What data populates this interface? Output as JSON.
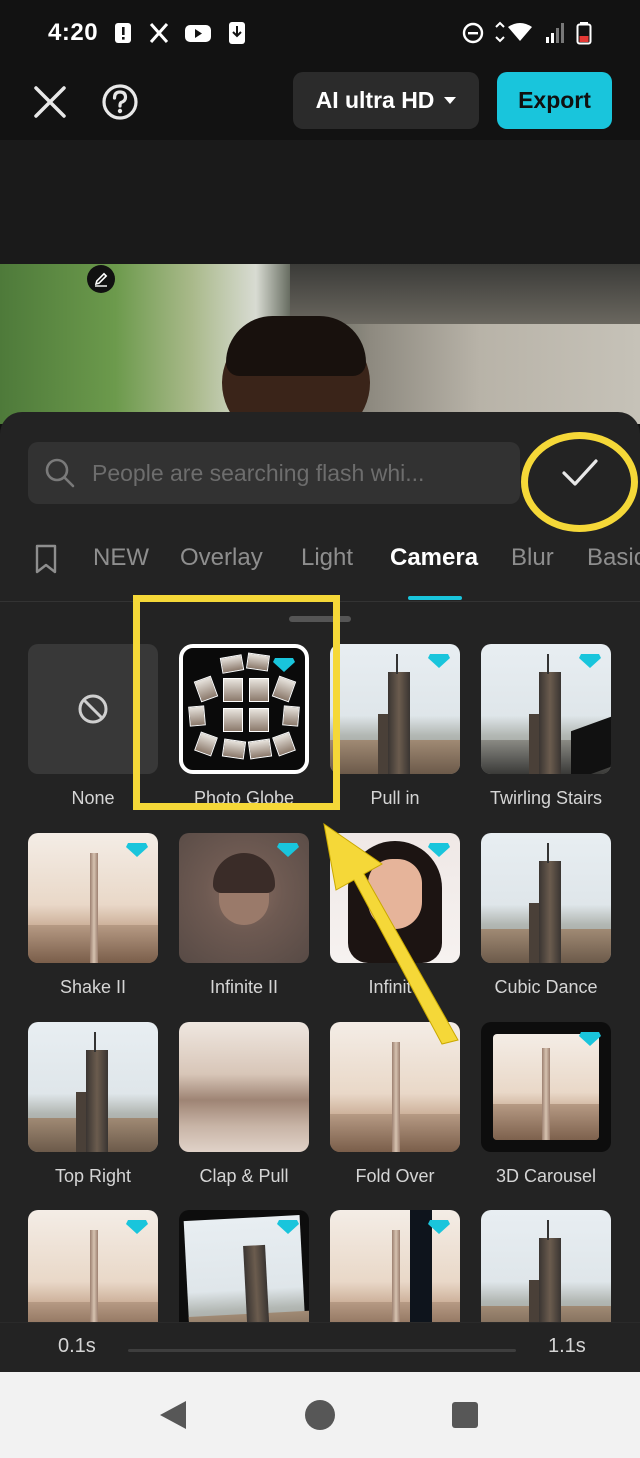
{
  "status_bar": {
    "time": "4:20"
  },
  "toolbar": {
    "quality_label": "AI ultra HD",
    "export_label": "Export"
  },
  "search": {
    "placeholder": "People are searching flash whi..."
  },
  "tabs": [
    "NEW",
    "Overlay",
    "Light",
    "Camera",
    "Blur",
    "Basic"
  ],
  "active_tab": "Camera",
  "effects": [
    {
      "label": "None",
      "premium": false
    },
    {
      "label": "Photo Globe",
      "premium": true,
      "selected": true
    },
    {
      "label": "Pull in",
      "premium": true
    },
    {
      "label": "Twirling Stairs",
      "premium": true
    },
    {
      "label": "Shake II",
      "premium": true
    },
    {
      "label": "Infinite II",
      "premium": true
    },
    {
      "label": "Infinite",
      "premium": true
    },
    {
      "label": "Cubic Dance",
      "premium": false
    },
    {
      "label": "Top Right",
      "premium": false
    },
    {
      "label": "Clap & Pull",
      "premium": false
    },
    {
      "label": "Fold Over",
      "premium": false
    },
    {
      "label": "3D Carousel",
      "premium": true
    }
  ],
  "speed": {
    "min_label": "0.1s",
    "max_label": "1.1s"
  },
  "colors": {
    "accent": "#19c5dc",
    "highlight": "#f5d838",
    "panel": "#232323"
  },
  "icons": [
    "close-icon",
    "help-icon",
    "pencil-icon",
    "search-icon",
    "checkmark-icon",
    "bookmark-icon",
    "ban-icon",
    "diamond-icon"
  ]
}
